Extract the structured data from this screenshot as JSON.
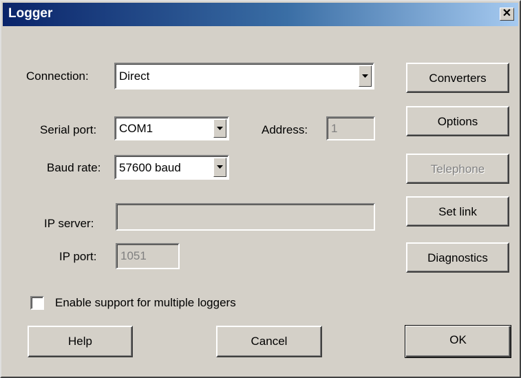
{
  "window": {
    "title": "Logger",
    "close_glyph": "✕"
  },
  "form": {
    "connection_label": "Connection:",
    "connection_value": "Direct",
    "serial_port_label": "Serial port:",
    "serial_port_value": "COM1",
    "address_label": "Address:",
    "address_value": "1",
    "baud_rate_label": "Baud rate:",
    "baud_rate_value": "57600 baud",
    "ip_server_label": "IP server:",
    "ip_server_value": "",
    "ip_port_label": "IP port:",
    "ip_port_value": "1051",
    "multiple_loggers_label": "Enable support for multiple loggers",
    "multiple_loggers_checked": false
  },
  "side_buttons": {
    "converters": "Converters",
    "options": "Options",
    "telephone": "Telephone",
    "set_link": "Set link",
    "diagnostics": "Diagnostics"
  },
  "bottom_buttons": {
    "help": "Help",
    "cancel": "Cancel",
    "ok": "OK"
  },
  "colors": {
    "face": "#d4d0c8",
    "titlebar_start": "#0a246a",
    "titlebar_end": "#a6caf0",
    "disabled_text": "#808080"
  },
  "icons": {
    "dropdown": "chevron-down-icon",
    "close": "close-icon"
  }
}
